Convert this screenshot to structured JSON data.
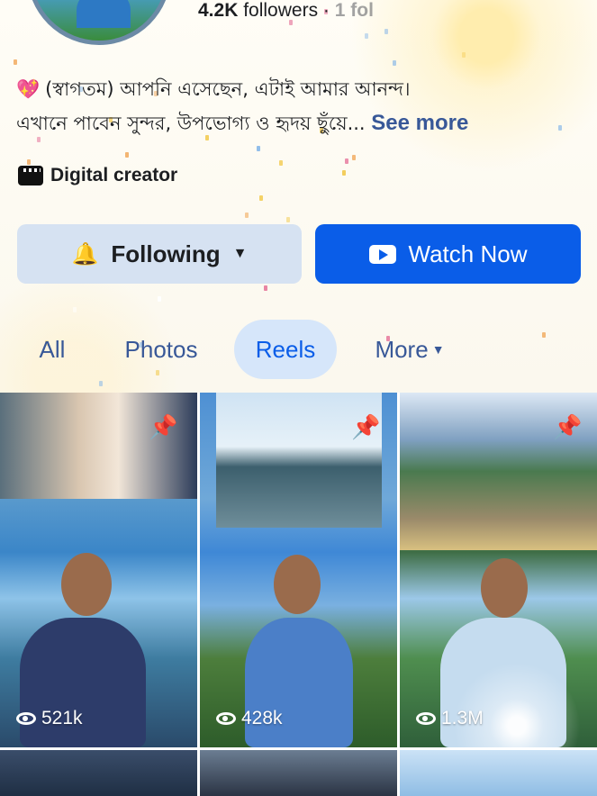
{
  "profile": {
    "followers_count": "4.2K",
    "followers_label": "followers",
    "separator": "·",
    "following_fragment": "1 fol"
  },
  "bio": {
    "emoji": "💖",
    "line1": "(স্বাগতম) আপনি এসেছেন, এটাই আমার আনন্দ।",
    "line2": "এখানে পাবেন সুন্দর, উপভোগ্য ও হৃদয় ছুঁয়ে...",
    "see_more": "See more"
  },
  "category": {
    "icon": "clapperboard-icon",
    "label": "Digital creator"
  },
  "actions": {
    "following_label": "Following",
    "following_icon": "bell-icon",
    "watch_label": "Watch Now",
    "watch_icon": "play-icon"
  },
  "tabs": [
    {
      "label": "All"
    },
    {
      "label": "Photos"
    },
    {
      "label": "Reels",
      "selected": true
    },
    {
      "label": "More"
    }
  ],
  "reels": [
    {
      "views": "521k",
      "pinned": true
    },
    {
      "views": "428k",
      "pinned": true
    },
    {
      "views": "1.3M",
      "pinned": true
    }
  ],
  "colors": {
    "accent": "#0a5de8",
    "link": "#385898",
    "following_bg": "#d6e2f2",
    "selected_tab_bg": "#d6e6fa"
  }
}
